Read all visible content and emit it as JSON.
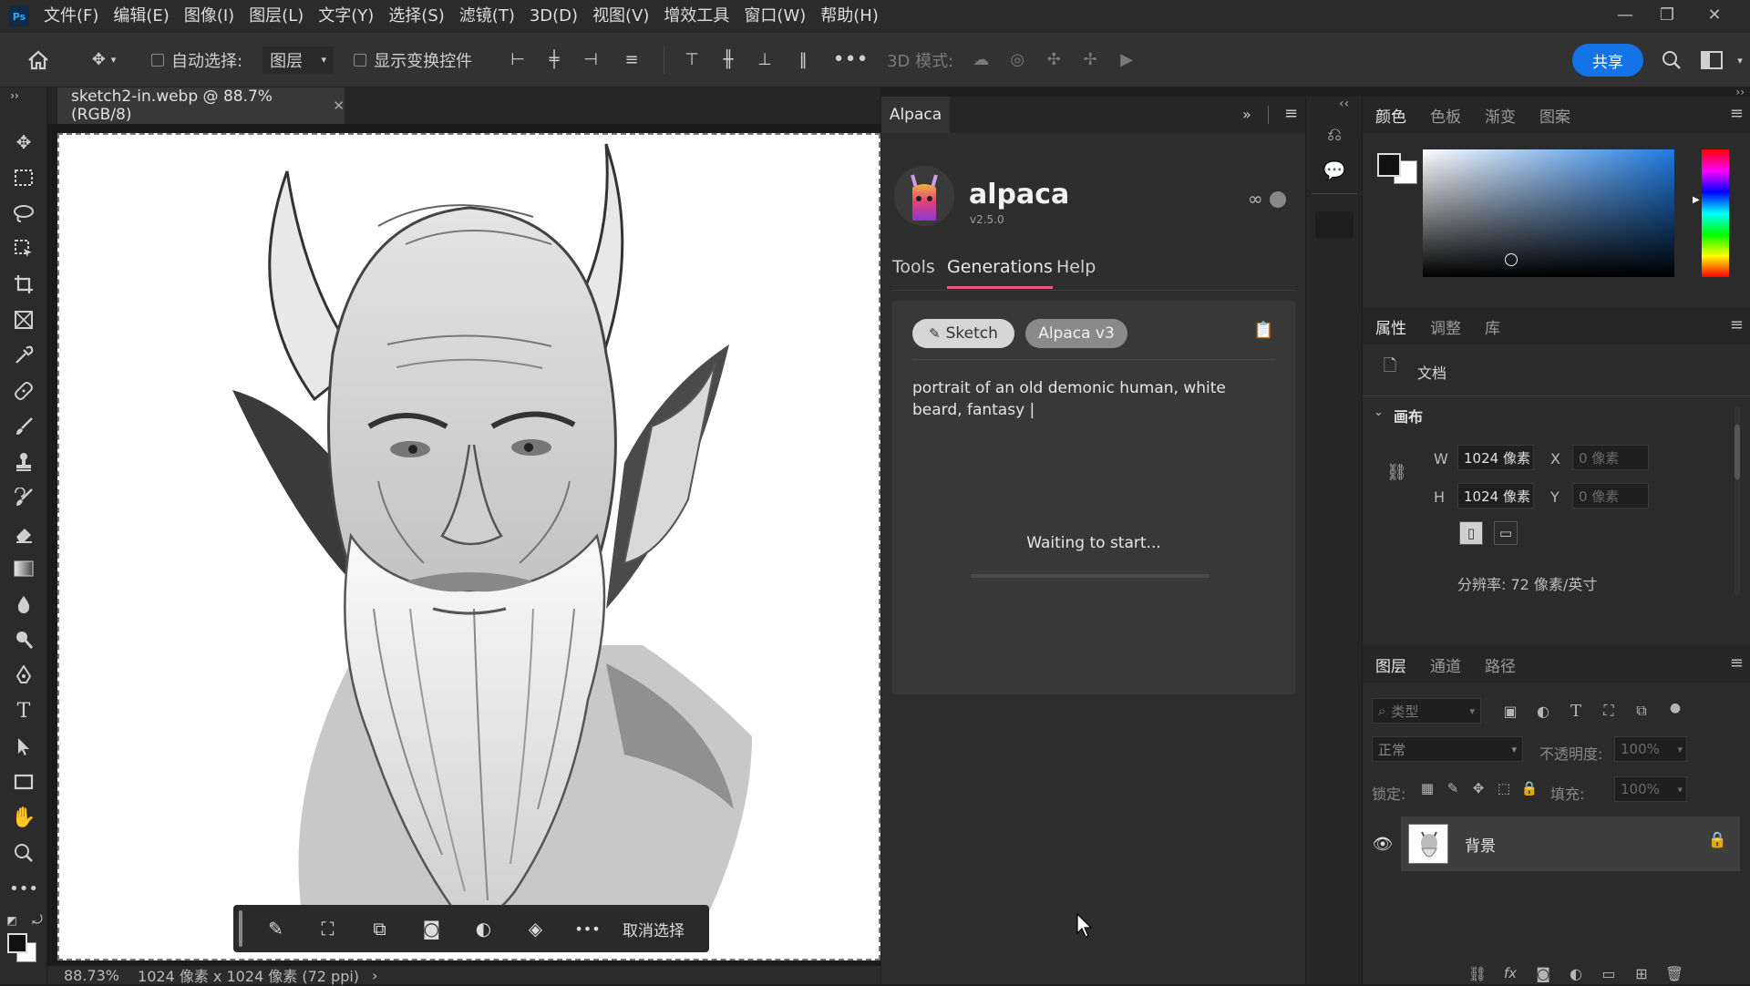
{
  "menu": {
    "logo": "Ps",
    "items": [
      "文件(F)",
      "编辑(E)",
      "图像(I)",
      "图层(L)",
      "文字(Y)",
      "选择(S)",
      "滤镜(T)",
      "3D(D)",
      "视图(V)",
      "增效工具",
      "窗口(W)",
      "帮助(H)"
    ]
  },
  "options": {
    "auto_select_label": "自动选择:",
    "layer_select_value": "图层",
    "show_transform_label": "显示变换控件",
    "mode_3d_label": "3D 模式:",
    "share_label": "共享"
  },
  "document": {
    "tab_title": "sketch2-in.webp @ 88.7%(RGB/8)",
    "zoom": "88.73%",
    "size_info": "1024 像素 x 1024 像素 (72 ppi)"
  },
  "context_bar": {
    "deselect_label": "取消选择"
  },
  "alpaca": {
    "panel_tab": "Alpaca",
    "app_name": "alpaca",
    "version": "v2.5.0",
    "infinity_symbol": "∞",
    "tabs": [
      "Tools",
      "Generations",
      "Help"
    ],
    "active_tab": "Generations",
    "chips": [
      "Sketch",
      "Alpaca v3"
    ],
    "prompt": "portrait of an old demonic human, white beard, fantasy |",
    "status": "Waiting to start..."
  },
  "color_panel": {
    "tabs": [
      "颜色",
      "色板",
      "渐变",
      "图案"
    ]
  },
  "properties": {
    "tabs": [
      "属性",
      "调整",
      "库"
    ],
    "doc_label": "文档",
    "canvas_label": "画布",
    "w_label": "W",
    "w_value": "1024 像素",
    "h_label": "H",
    "h_value": "1024 像素",
    "x_label": "X",
    "x_value": "0 像素",
    "y_label": "Y",
    "y_value": "0 像素",
    "resolution": "分辨率: 72 像素/英寸"
  },
  "layers": {
    "tabs": [
      "图层",
      "通道",
      "路径"
    ],
    "filter_placeholder": "类型",
    "blend_mode": "正常",
    "opacity_label": "不透明度:",
    "opacity_value": "100%",
    "lock_label": "锁定:",
    "fill_label": "填充:",
    "fill_value": "100%",
    "layer_name": "背景"
  },
  "colors": {
    "accent": "#1473e6",
    "generations_underline": "#e85a7a"
  }
}
